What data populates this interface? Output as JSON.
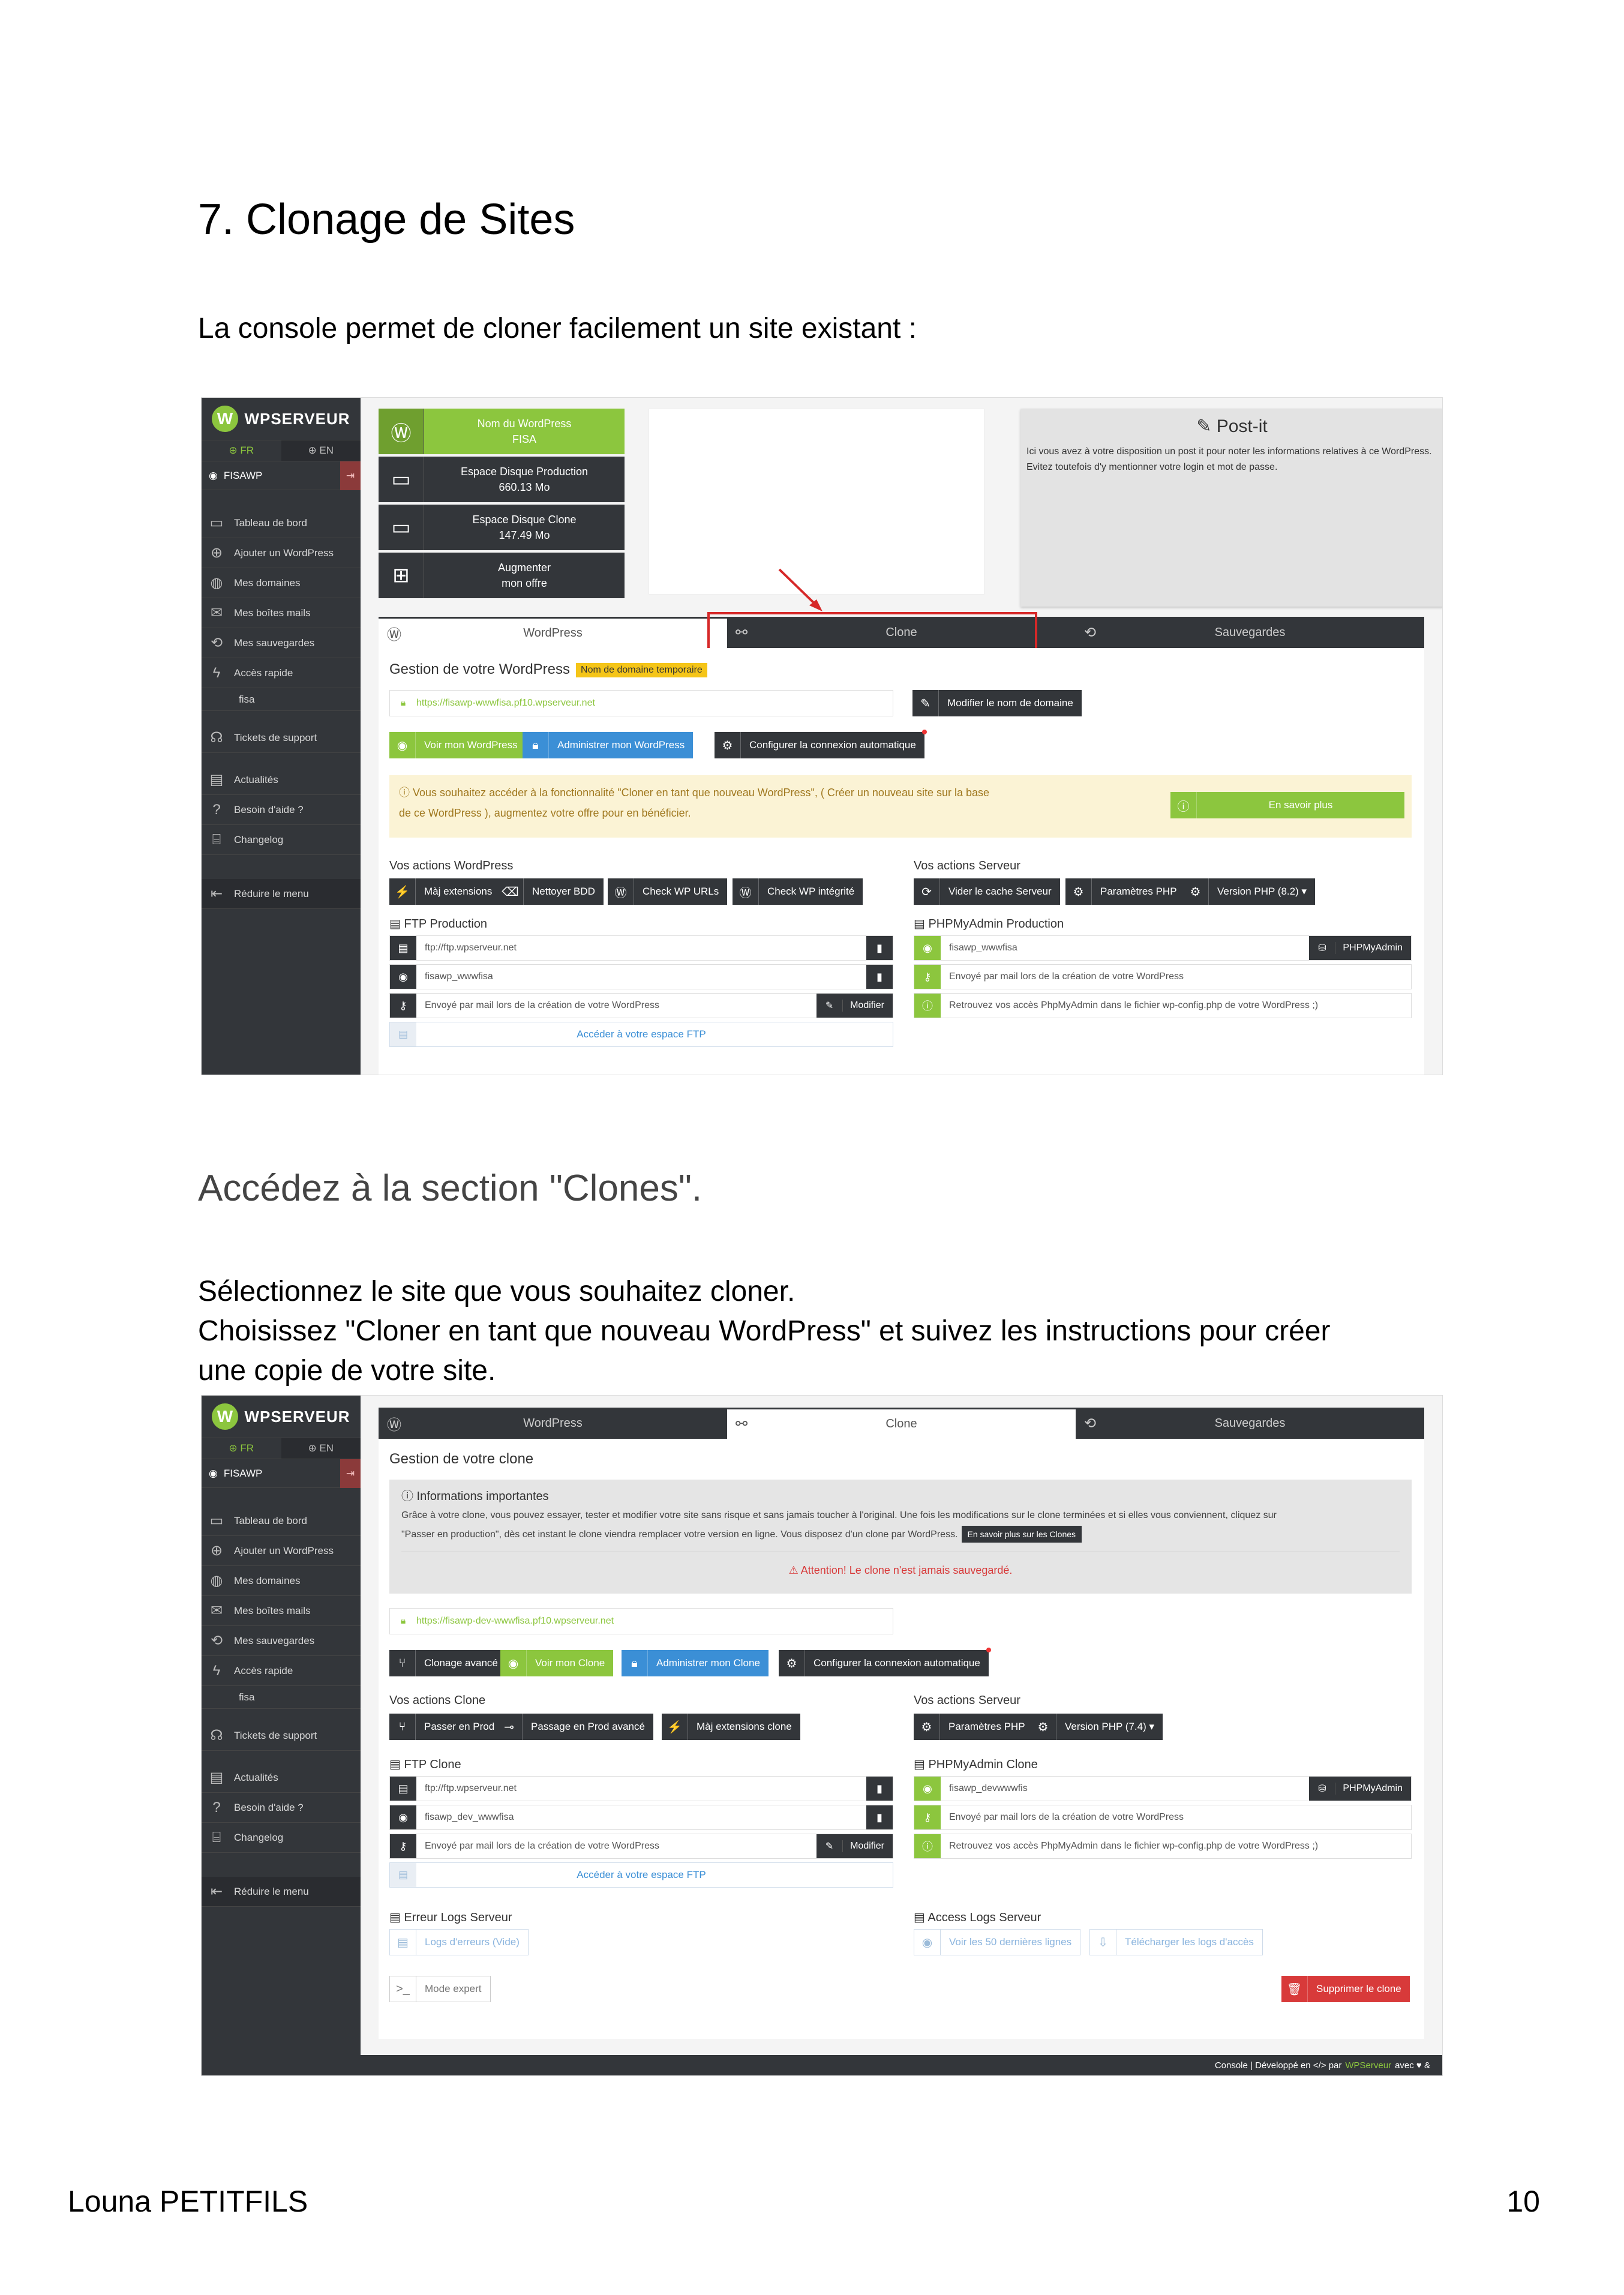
{
  "doc": {
    "heading": "7. Clonage de Sites",
    "intro": "La console permet de cloner facilement un site existant :",
    "section": "Accédez à la section \"Clones\".",
    "step1": "Sélectionnez le site que vous souhaitez cloner.",
    "step2a": "Choisissez \"Cloner en tant que nouveau WordPress\" et suivez les instructions pour créer",
    "step2b": "une copie de votre site.",
    "author": "Louna PETITFILS",
    "page": "10"
  },
  "sidebar": {
    "brand": "WPSERVEUR",
    "lang_fr": "FR",
    "lang_en": "EN",
    "user": "FISAWP",
    "items": [
      "Tableau de bord",
      "Ajouter un WordPress",
      "Mes domaines",
      "Mes boîtes mails",
      "Mes sauvegardes",
      "Accès rapide",
      "fisa",
      "Tickets de support",
      "Actualités",
      "Besoin d'aide ?",
      "Changelog",
      "Réduire le menu"
    ]
  },
  "shot1": {
    "stats": [
      {
        "l1": "Nom du WordPress",
        "l2": "FISA"
      },
      {
        "l1": "Espace Disque Production",
        "l2": "660.13 Mo"
      },
      {
        "l1": "Espace Disque Clone",
        "l2": "147.49 Mo"
      },
      {
        "l1": "Augmenter",
        "l2": "mon offre"
      }
    ],
    "postit_title": "Post-it",
    "postit_text": "Ici vous avez à votre disposition un post it pour noter les informations relatives à ce WordPress. Evitez toutefois d'y mentionner votre login et mot de passe.",
    "tabs": [
      "WordPress",
      "Clone",
      "Sauvegardes"
    ],
    "title": "Gestion de votre WordPress",
    "badge": "Nom de domaine temporaire",
    "url": "https://fisawp-wwwfisa.pf10.wpserveur.net",
    "btn_domain": "Modifier le nom de domaine",
    "btn_view": "Voir mon WordPress",
    "btn_admin": "Administrer mon WordPress",
    "btn_autologin": "Configurer la connexion automatique",
    "notice1": "ⓘ Vous souhaitez accéder à la fonctionnalité \"Cloner en tant que nouveau WordPress\", ( Créer un nouveau site sur la base",
    "notice2": "de ce WordPress ), augmentez votre offre pour en bénéficier.",
    "btn_more": "En savoir plus",
    "wp_actions": "Vos actions WordPress",
    "wp_btns": [
      "Màj extensions",
      "Nettoyer BDD",
      "Check WP URLs",
      "Check WP intégrité"
    ],
    "srv_actions": "Vos actions Serveur",
    "srv_btns": [
      "Vider le cache Serveur",
      "Paramètres PHP",
      "Version PHP (8.2) ▾"
    ],
    "ftp_title": "FTP Production",
    "ftp_host": "ftp://ftp.wpserveur.net",
    "ftp_user": "fisawp_wwwfisa",
    "ftp_pass": "Envoyé par mail lors de la création de votre WordPress",
    "btn_modify": "Modifier",
    "ftp_access": "Accéder à votre espace FTP",
    "pma_title": "PHPMyAdmin Production",
    "pma_user": "fisawp_wwwfisa",
    "pma_btn": "PHPMyAdmin",
    "pma_pass": "Envoyé par mail lors de la création de votre WordPress",
    "pma_info": "Retrouvez vos accès PhpMyAdmin dans le fichier wp-config.php de votre WordPress ;)"
  },
  "shot2": {
    "tabs": [
      "WordPress",
      "Clone",
      "Sauvegardes"
    ],
    "title": "Gestion de votre clone",
    "info_title": "ⓘ Informations importantes",
    "info1": "Grâce à votre clone, vous pouvez essayer, tester et modifier votre site sans risque et sans jamais toucher à l'original. Une fois les modifications sur le clone terminées et si elles vous conviennent, cliquez sur",
    "info2": "\"Passer en production\", dès cet instant le clone viendra remplacer votre version en ligne. Vous disposez d'un clone par WordPress.",
    "info_btn": "En savoir plus sur les Clones",
    "warn": "⚠ Attention! Le clone n'est jamais sauvegardé.",
    "url": "https://fisawp-dev-wwwfisa.pf10.wpserveur.net",
    "btn_adv": "Clonage avancé",
    "btn_view": "Voir mon Clone",
    "btn_admin": "Administrer mon Clone",
    "btn_autologin": "Configurer la connexion automatique",
    "clone_actions": "Vos actions Clone",
    "clone_btns": [
      "Passer en Prod",
      "Passage en Prod avancé",
      "Màj extensions clone"
    ],
    "srv_actions": "Vos actions Serveur",
    "srv_btns": [
      "Paramètres PHP",
      "Version PHP (7.4) ▾"
    ],
    "ftp_title": "FTP Clone",
    "ftp_host": "ftp://ftp.wpserveur.net",
    "ftp_user": "fisawp_dev_wwwfisa",
    "ftp_pass": "Envoyé par mail lors de la création de votre WordPress",
    "btn_modify": "Modifier",
    "ftp_access": "Accéder à votre espace FTP",
    "pma_title": "PHPMyAdmin Clone",
    "pma_user": "fisawp_devwwwfis",
    "pma_btn": "PHPMyAdmin",
    "pma_pass": "Envoyé par mail lors de la création de votre WordPress",
    "pma_info": "Retrouvez vos accès PhpMyAdmin dans le fichier wp-config.php de votre WordPress ;)",
    "err_title": "Erreur Logs Serveur",
    "err_btn": "Logs d'erreurs (Vide)",
    "acc_title": "Access Logs Serveur",
    "acc_btn1": "Voir les 50 dernières lignes",
    "acc_btn2": "Télécharger les logs d'accès",
    "expert": "Mode expert",
    "delete": "Supprimer le clone",
    "footer_a": "Console | Développé en",
    "footer_b": "par",
    "footer_brand": "WPServeur",
    "footer_c": "avec ♥ &"
  }
}
